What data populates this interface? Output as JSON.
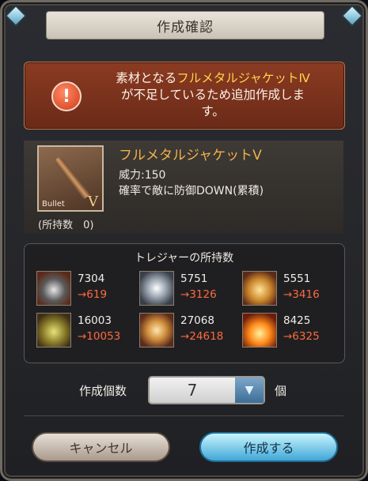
{
  "title": "作成確認",
  "warning": {
    "line1_prefix": "素材となる",
    "line1_highlight": "フルメタルジャケットⅣ",
    "line2": "が不足しているため追加作成しま",
    "line3": "す。",
    "icon": "exclamation-icon"
  },
  "item": {
    "name": "フルメタルジャケットⅤ",
    "icon_label": "Bullet",
    "icon_rank": "V",
    "description": "威力:150\n確率で敵に防御DOWN(累積)",
    "owned_label": "(所持数　0)"
  },
  "treasure": {
    "title": "トレジャーの所持数",
    "items": [
      {
        "have": "7304",
        "after": "→619"
      },
      {
        "have": "5751",
        "after": "→3126"
      },
      {
        "have": "5551",
        "after": "→3416"
      },
      {
        "have": "16003",
        "after": "→10053"
      },
      {
        "have": "27068",
        "after": "→24618"
      },
      {
        "have": "8425",
        "after": "→6325"
      }
    ]
  },
  "quantity": {
    "label": "作成個数",
    "value": "7",
    "unit": "個"
  },
  "buttons": {
    "cancel": "キャンセル",
    "create": "作成する"
  },
  "colors": {
    "highlight": "#ffd34d",
    "shortfall": "#ff6a3d",
    "item_name": "#f2b24a"
  }
}
